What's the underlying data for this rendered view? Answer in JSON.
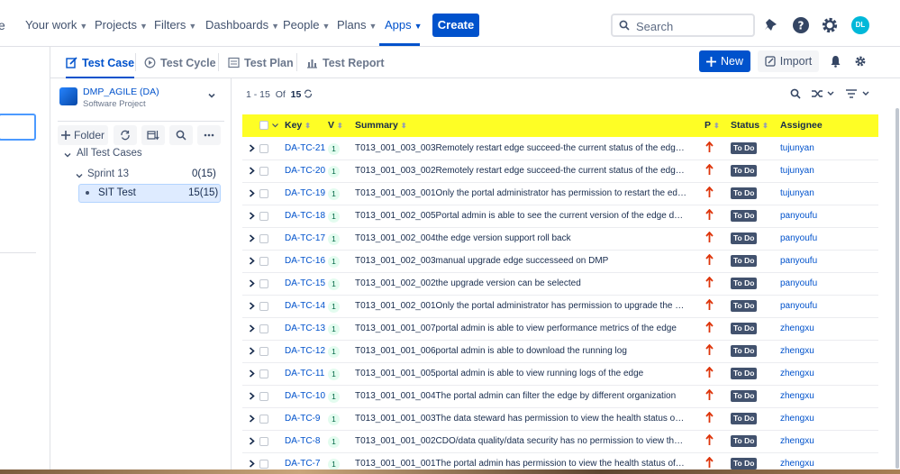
{
  "topnav": {
    "partial_label": "e",
    "items": [
      {
        "label": "Your work"
      },
      {
        "label": "Projects"
      },
      {
        "label": "Filters"
      },
      {
        "label": "Dashboards"
      },
      {
        "label": "People"
      },
      {
        "label": "Plans"
      },
      {
        "label": "Apps"
      }
    ],
    "create_label": "Create",
    "search_placeholder": "Search",
    "avatar_initials": "DL"
  },
  "tabs": [
    "Test Case",
    "Test Cycle",
    "Test Plan",
    "Test Report"
  ],
  "actions": {
    "new_label": "New",
    "import_label": "Import"
  },
  "project": {
    "name": "DMP_AGILE (DA)",
    "type": "Software Project"
  },
  "folder_toolbar": {
    "folder_label": "Folder"
  },
  "tree": {
    "all_label": "All Test Cases",
    "sprint_label": "Sprint 13",
    "sprint_count": "0(15)",
    "sit_label": "SIT Test",
    "sit_count": "15(15)"
  },
  "pager": {
    "range": "1 - 15",
    "of_label": "Of",
    "total": "15"
  },
  "columns": {
    "key": "Key",
    "v": "V",
    "summary": "Summary",
    "p": "P",
    "status": "Status",
    "assignee": "Assignee"
  },
  "rows": [
    {
      "key": "DA-TC-21",
      "v": "1",
      "summary": "T013_001_003_003Remotely restart edge succeed-the current status of the edge is online",
      "status": "To Do",
      "assignee": "tujunyan"
    },
    {
      "key": "DA-TC-20",
      "v": "1",
      "summary": "T013_001_003_002Remotely restart edge succeed-the current status of the edge is offline",
      "status": "To Do",
      "assignee": "tujunyan"
    },
    {
      "key": "DA-TC-19",
      "v": "1",
      "summary": "T013_001_003_001Only the portal administrator has permission to restart the edge",
      "status": "To Do",
      "assignee": "tujunyan"
    },
    {
      "key": "DA-TC-18",
      "v": "1",
      "summary": "T013_001_002_005Portal admin is able to see the current version of the edge deployment",
      "status": "To Do",
      "assignee": "panyoufu"
    },
    {
      "key": "DA-TC-17",
      "v": "1",
      "summary": "T013_001_002_004the edge version support roll back",
      "status": "To Do",
      "assignee": "panyoufu"
    },
    {
      "key": "DA-TC-16",
      "v": "1",
      "summary": "T013_001_002_003manual upgrade edge successeed on DMP",
      "status": "To Do",
      "assignee": "panyoufu"
    },
    {
      "key": "DA-TC-15",
      "v": "1",
      "summary": "T013_001_002_002the upgrade version can be selected",
      "status": "To Do",
      "assignee": "panyoufu"
    },
    {
      "key": "DA-TC-14",
      "v": "1",
      "summary": "T013_001_002_001Only the portal administrator has permission to upgrade the edge",
      "status": "To Do",
      "assignee": "panyoufu"
    },
    {
      "key": "DA-TC-13",
      "v": "1",
      "summary": "T013_001_001_007portal admin is able to view performance metrics of the edge",
      "status": "To Do",
      "assignee": "zhengxu"
    },
    {
      "key": "DA-TC-12",
      "v": "1",
      "summary": "T013_001_001_006portal admin is able to download the running log",
      "status": "To Do",
      "assignee": "zhengxu"
    },
    {
      "key": "DA-TC-11",
      "v": "1",
      "summary": "T013_001_001_005portal admin is able to view running logs of the edge",
      "status": "To Do",
      "assignee": "zhengxu"
    },
    {
      "key": "DA-TC-10",
      "v": "1",
      "summary": "T013_001_001_004The portal admin can filter the edge by different organization",
      "status": "To Do",
      "assignee": "zhengxu"
    },
    {
      "key": "DA-TC-9",
      "v": "1",
      "summary": "T013_001_001_003The data steward has permission to view the health status of the edge",
      "status": "To Do",
      "assignee": "zhengxu"
    },
    {
      "key": "DA-TC-8",
      "v": "1",
      "summary": "T013_001_001_002CDO/data quality/data security has no permission to view the health status",
      "status": "To Do",
      "assignee": "zhengxu"
    },
    {
      "key": "DA-TC-7",
      "v": "1",
      "summary": "T013_001_001_001The portal admin has permission to view the health status of the edge",
      "status": "To Do",
      "assignee": "zhengxu"
    }
  ],
  "colors": {
    "accent": "#0052cc",
    "highlight": "#ffff00",
    "priority": "#de350b",
    "status_bg": "#42526e"
  }
}
